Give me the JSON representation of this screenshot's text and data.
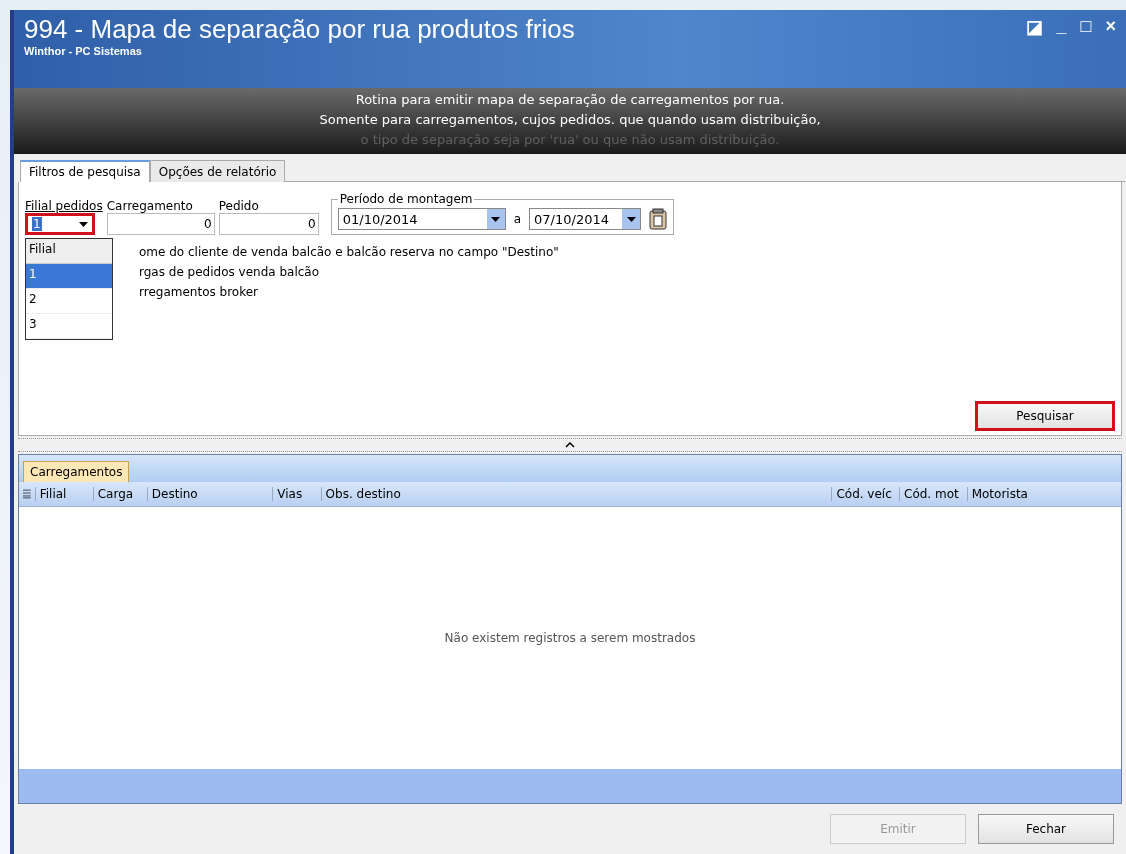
{
  "window": {
    "title": "994 - Mapa de separação por rua produtos frios",
    "subtitle": "Winthor - PC Sistemas",
    "controls": [
      "◪",
      "_",
      "□",
      "×"
    ]
  },
  "banner": [
    "Rotina para emitir mapa de separação de carregamentos por rua.",
    "Somente para carregamentos, cujos pedidos. que quando usam distribuição,",
    "o tipo de separação seja por 'rua' ou que não usam distribuição."
  ],
  "tabs": [
    {
      "label": "Filtros de pesquisa",
      "selected": true
    },
    {
      "label": "Opções de relatório",
      "selected": false
    }
  ],
  "filters": {
    "filial": {
      "label": "Filial pedidos",
      "value": "1",
      "highlighted": true,
      "dropdown": {
        "header": "Filial",
        "options": [
          {
            "label": "1",
            "selected": true
          },
          {
            "label": "2",
            "selected": false
          },
          {
            "label": "3",
            "selected": false
          }
        ]
      }
    },
    "carregamento": {
      "label": "Carregamento",
      "value": "0"
    },
    "pedido": {
      "label": "Pedido",
      "value": "0"
    },
    "periodo": {
      "label": "Período de montagem",
      "from": "01/10/2014",
      "separator": "a",
      "to": "07/10/2014"
    },
    "options": [
      "ome do cliente de venda balcão e balcão reserva no campo \"Destino\"",
      "rgas de pedidos venda balcão",
      "rregamentos broker"
    ]
  },
  "search_button": {
    "label": "Pesquisar",
    "highlighted": true
  },
  "grid": {
    "tab": "Carregamentos",
    "columns": [
      "Filial",
      "Carga",
      "Destino",
      "Vias",
      "Obs. destino",
      "Cód. veíc",
      "Cód. mot",
      "Motorista"
    ],
    "empty_message": "Não existem registros a serem mostrados"
  },
  "buttons": [
    {
      "label": "Emitir",
      "disabled": true
    },
    {
      "label": "Fechar",
      "disabled": false
    }
  ]
}
